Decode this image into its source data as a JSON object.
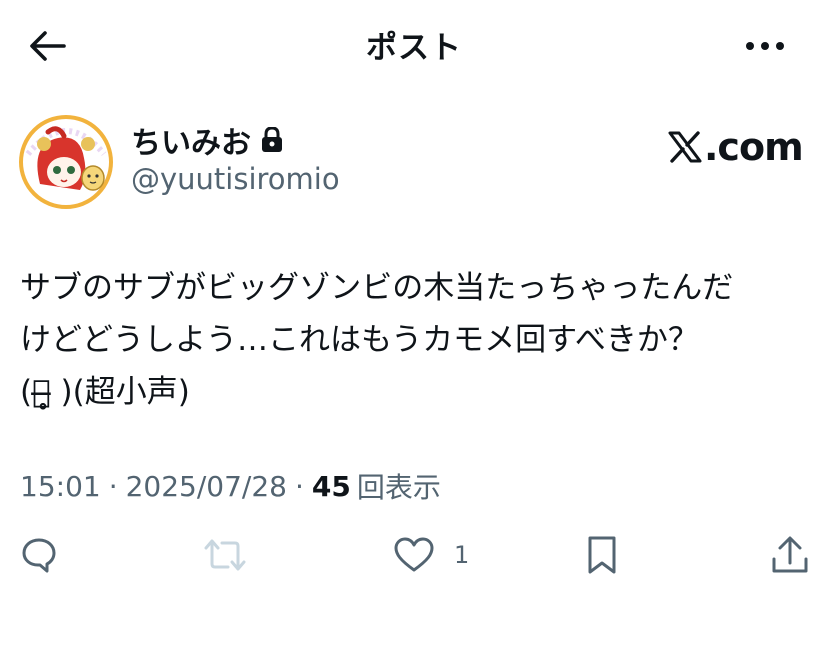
{
  "header": {
    "title": "ポスト",
    "back_icon": "arrow-left-icon",
    "more_icon": "more-horizontal-icon"
  },
  "author": {
    "display_name": "ちいみお",
    "protected_icon": "lock-icon",
    "handle": "@yuutisiromio",
    "avatar_icon": "avatar-image"
  },
  "watermark": {
    "x_logo": "𝕏",
    "domain": ".com"
  },
  "tweet": {
    "lines": [
      "サブのサブがビッグゾンビの木当たっちゃったんだ",
      "けどどうしよう…これはもうカモメ回すべきか？",
      "(ᯣ̶̥̥ )(超小声)"
    ]
  },
  "meta": {
    "time": "15:01",
    "separator1": "·",
    "date": "2025/07/28",
    "separator2": "·",
    "views_count": "45",
    "views_label": "回表示"
  },
  "actions": {
    "reply_icon": "reply-icon",
    "retweet_icon": "retweet-icon",
    "like_icon": "heart-icon",
    "like_count": "1",
    "bookmark_icon": "bookmark-icon",
    "share_icon": "share-icon"
  },
  "colors": {
    "text": "#0f1419",
    "secondary": "#536471",
    "retweet_disabled": "#c8d6df",
    "avatar_ring": "#f2b33d"
  }
}
